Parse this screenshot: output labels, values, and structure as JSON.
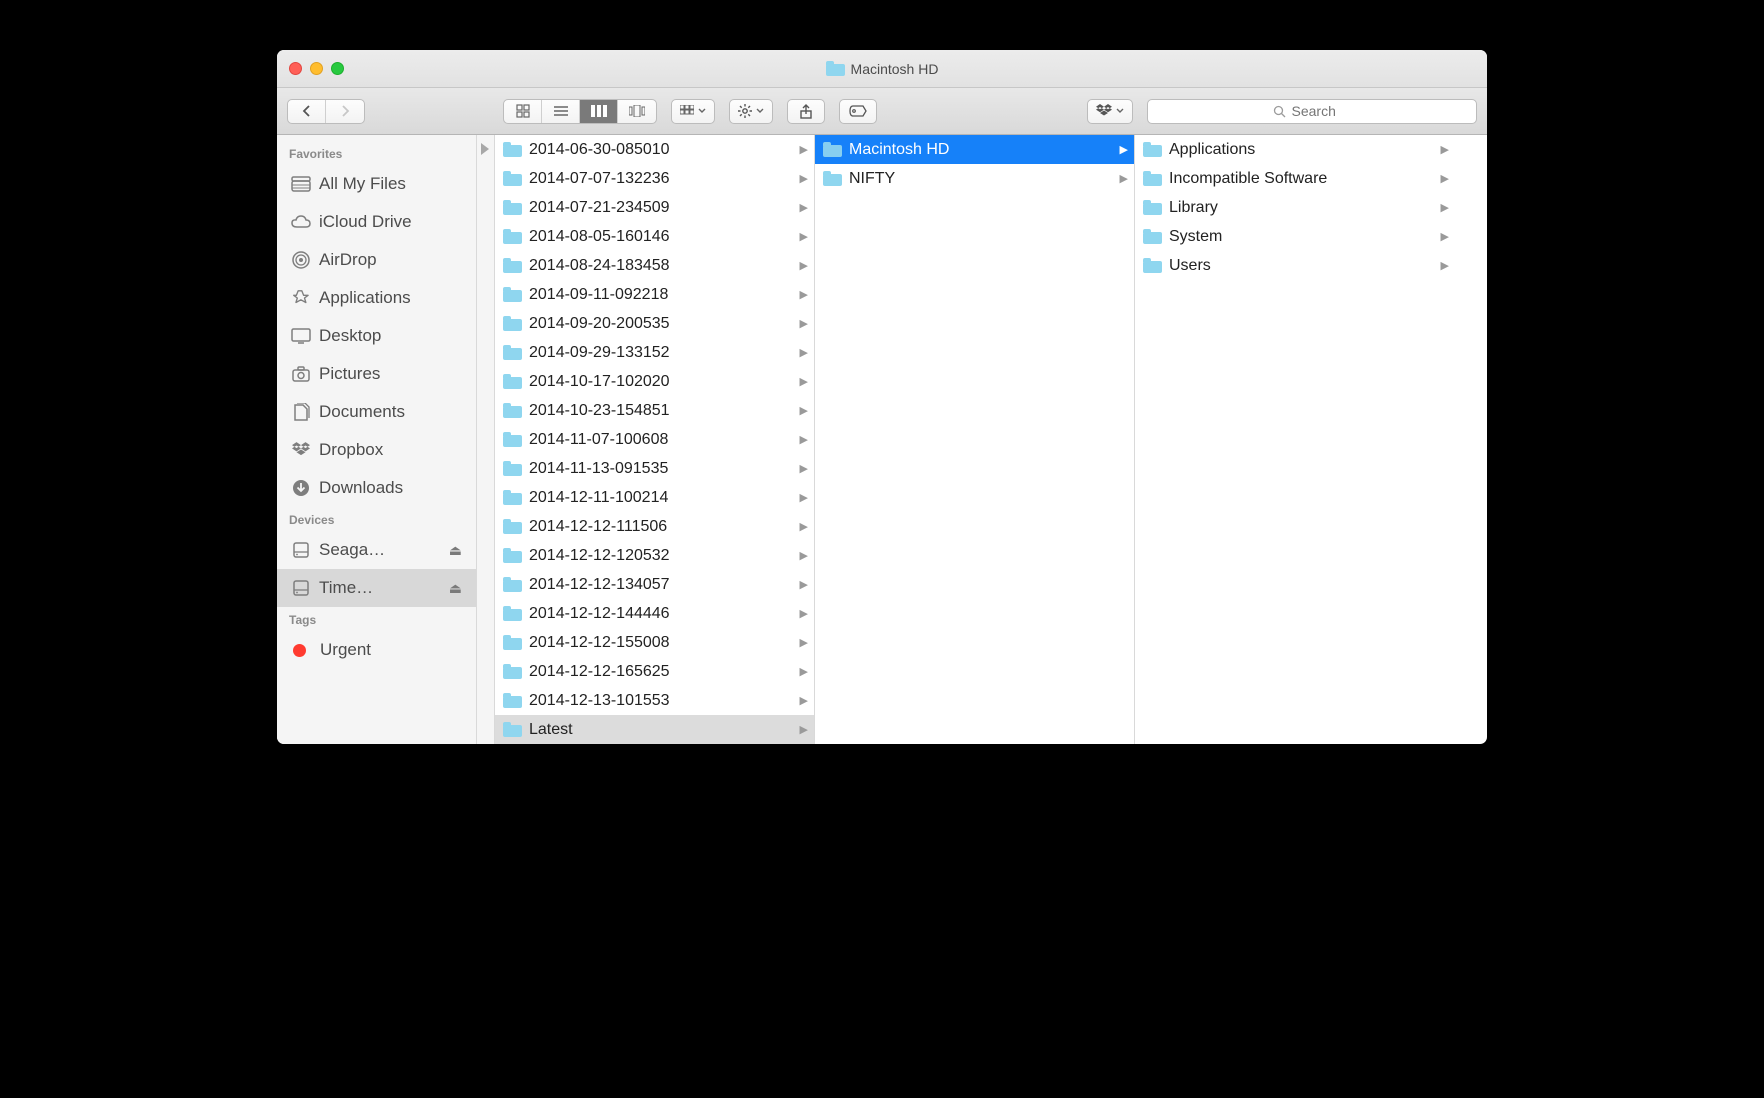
{
  "window": {
    "title": "Macintosh HD"
  },
  "search": {
    "placeholder": "Search"
  },
  "sidebar": {
    "sections": [
      {
        "header": "Favorites",
        "items": [
          {
            "label": "All My Files",
            "icon": "all-my-files"
          },
          {
            "label": "iCloud Drive",
            "icon": "icloud"
          },
          {
            "label": "AirDrop",
            "icon": "airdrop"
          },
          {
            "label": "Applications",
            "icon": "applications"
          },
          {
            "label": "Desktop",
            "icon": "desktop"
          },
          {
            "label": "Pictures",
            "icon": "pictures"
          },
          {
            "label": "Documents",
            "icon": "documents"
          },
          {
            "label": "Dropbox",
            "icon": "dropbox"
          },
          {
            "label": "Downloads",
            "icon": "downloads"
          }
        ]
      },
      {
        "header": "Devices",
        "items": [
          {
            "label": "Seaga…",
            "icon": "hdd",
            "eject": true
          },
          {
            "label": "Time…",
            "icon": "hdd",
            "eject": true,
            "selected": true
          }
        ]
      },
      {
        "header": "Tags",
        "items": [
          {
            "label": "Urgent",
            "icon": "tag-red"
          }
        ]
      }
    ]
  },
  "columns": [
    {
      "items": [
        {
          "name": "2014-06-30-085010"
        },
        {
          "name": "2014-07-07-132236"
        },
        {
          "name": "2014-07-21-234509"
        },
        {
          "name": "2014-08-05-160146"
        },
        {
          "name": "2014-08-24-183458"
        },
        {
          "name": "2014-09-11-092218"
        },
        {
          "name": "2014-09-20-200535"
        },
        {
          "name": "2014-09-29-133152"
        },
        {
          "name": "2014-10-17-102020"
        },
        {
          "name": "2014-10-23-154851"
        },
        {
          "name": "2014-11-07-100608"
        },
        {
          "name": "2014-11-13-091535"
        },
        {
          "name": "2014-12-11-100214"
        },
        {
          "name": "2014-12-12-111506"
        },
        {
          "name": "2014-12-12-120532"
        },
        {
          "name": "2014-12-12-134057"
        },
        {
          "name": "2014-12-12-144446"
        },
        {
          "name": "2014-12-12-155008"
        },
        {
          "name": "2014-12-12-165625"
        },
        {
          "name": "2014-12-13-101553"
        },
        {
          "name": "Latest",
          "selected_grey": true
        }
      ]
    },
    {
      "items": [
        {
          "name": "Macintosh HD",
          "selected": true
        },
        {
          "name": "NIFTY"
        }
      ]
    },
    {
      "items": [
        {
          "name": "Applications"
        },
        {
          "name": "Incompatible Software"
        },
        {
          "name": "Library"
        },
        {
          "name": "System"
        },
        {
          "name": "Users"
        }
      ]
    }
  ]
}
